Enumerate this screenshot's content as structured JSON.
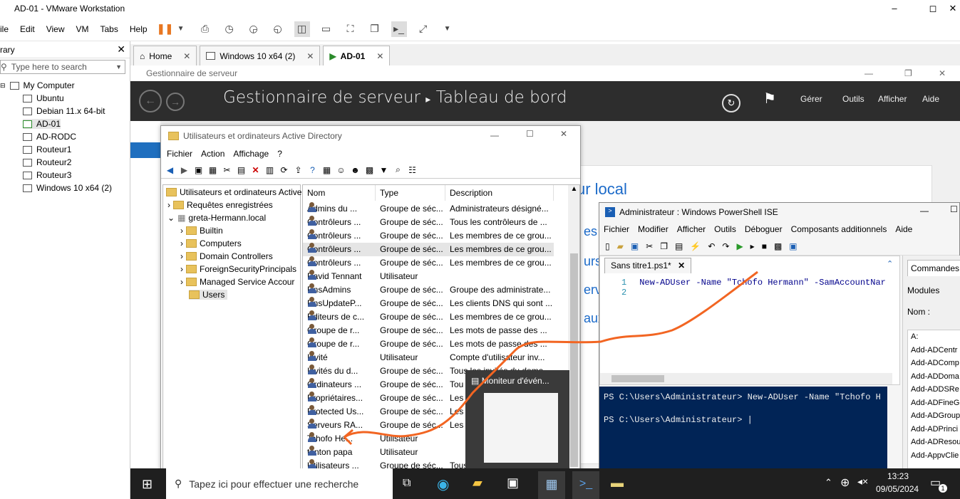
{
  "window": {
    "title": "AD-01 - VMware Workstation"
  },
  "menu": [
    "ile",
    "Edit",
    "View",
    "VM",
    "Tabs",
    "Help"
  ],
  "library": {
    "title": "rary",
    "search_placeholder": "Type here to search",
    "root": "My Computer",
    "items": [
      "Ubuntu",
      "Debian 11.x 64-bit",
      "AD-01",
      "AD-RODC",
      "Routeur1",
      "Routeur2",
      "Routeur3",
      "Windows 10 x64 (2)"
    ]
  },
  "tabs": [
    {
      "label": "Home"
    },
    {
      "label": "Windows 10 x64 (2)"
    },
    {
      "label": "AD-01"
    }
  ],
  "server_manager": {
    "title": "Gestionnaire de serveur",
    "breadcrumb1": "Gestionnaire de serveur",
    "breadcrumb2": "Tableau de bord",
    "menu": [
      "Gérer",
      "Outils",
      "Afficher",
      "Aide"
    ],
    "bg_texts": [
      "ur local",
      "es fo",
      "urs",
      "erve",
      "aux"
    ]
  },
  "aduc": {
    "title": "Utilisateurs et ordinateurs Active Directory",
    "menu": [
      "Fichier",
      "Action",
      "Affichage",
      "?"
    ],
    "tree": {
      "root": "Utilisateurs et ordinateurs Active",
      "saved": "Requêtes enregistrées",
      "domain": "greta-Hermann.local",
      "children": [
        "Builtin",
        "Computers",
        "Domain Controllers",
        "ForeignSecurityPrincipals",
        "Managed Service Accour",
        "Users"
      ]
    },
    "columns": [
      "Nom",
      "Type",
      "Description"
    ],
    "rows": [
      [
        "Admins du ...",
        "Groupe de séc...",
        "Administrateurs désigné..."
      ],
      [
        "Contrôleurs ...",
        "Groupe de séc...",
        "Tous les contrôleurs de ..."
      ],
      [
        "Contrôleurs ...",
        "Groupe de séc...",
        "Les membres de ce grou..."
      ],
      [
        "Contrôleurs ...",
        "Groupe de séc...",
        "Les membres de ce grou..."
      ],
      [
        "Contrôleurs ...",
        "Groupe de séc...",
        "Les membres de ce grou..."
      ],
      [
        "David Tennant",
        "Utilisateur",
        ""
      ],
      [
        "DnsAdmins",
        "Groupe de séc...",
        "Groupe des administrate..."
      ],
      [
        "DnsUpdateP...",
        "Groupe de séc...",
        "Les clients DNS qui sont ..."
      ],
      [
        "Éditeurs de c...",
        "Groupe de séc...",
        "Les membres de ce grou..."
      ],
      [
        "Groupe de r...",
        "Groupe de séc...",
        "Les mots de passe des ..."
      ],
      [
        "Groupe de r...",
        "Groupe de séc...",
        "Les mots de passe des ..."
      ],
      [
        "Invité",
        "Utilisateur",
        "Compte d'utilisateur inv..."
      ],
      [
        "Invités du d...",
        "Groupe de séc...",
        "Tous les invités du doma..."
      ],
      [
        "Ordinateurs ...",
        "Groupe de séc...",
        "Tou"
      ],
      [
        "Propriétaires...",
        "Groupe de séc...",
        "Les"
      ],
      [
        "Protected Us...",
        "Groupe de séc...",
        "Les m"
      ],
      [
        "Serveurs RA...",
        "Groupe de séc...",
        "Les se"
      ],
      [
        "Tchofo He...",
        "Utilisateur",
        ""
      ],
      [
        "tonton papa",
        "Utilisateur",
        ""
      ],
      [
        "Utilisateurs ...",
        "Groupe de séc...",
        "Tous les utilisateurs du d..."
      ]
    ]
  },
  "ise": {
    "title": "Administrateur : Windows PowerShell ISE",
    "menu": [
      "Fichier",
      "Modifier",
      "Afficher",
      "Outils",
      "Déboguer",
      "Composants additionnels",
      "Aide"
    ],
    "tab": "Sans titre1.ps1*",
    "lines": [
      {
        "n": "1",
        "code": "New-ADUser -Name \"Tchofo Hermann\" -SamAccountNar"
      },
      {
        "n": "2",
        "code": ""
      }
    ],
    "console": [
      "PS C:\\Users\\Administrateur> New-ADUser -Name \"Tchofo H",
      "PS C:\\Users\\Administrateur> |"
    ],
    "commands": {
      "tab": "Commandes",
      "modules": "Modules",
      "name": "Nom :",
      "list": [
        "A:",
        "Add-ADCentr",
        "Add-ADComp",
        "Add-ADDoma",
        "Add-ADDSRe",
        "Add-ADFineG",
        "Add-ADGroup",
        "Add-ADPrinci",
        "Add-ADResou",
        "Add-AppvClie"
      ]
    }
  },
  "thumb": {
    "title": "Moniteur d'évén..."
  },
  "taskbar": {
    "search": "Tapez ici pour effectuer une recherche",
    "time": "13:23",
    "date": "09/05/2024",
    "notif": "1"
  },
  "colors": {
    "sm_header": "#2d2d2d",
    "ps_console": "#012456",
    "annotation": "#f26522"
  }
}
